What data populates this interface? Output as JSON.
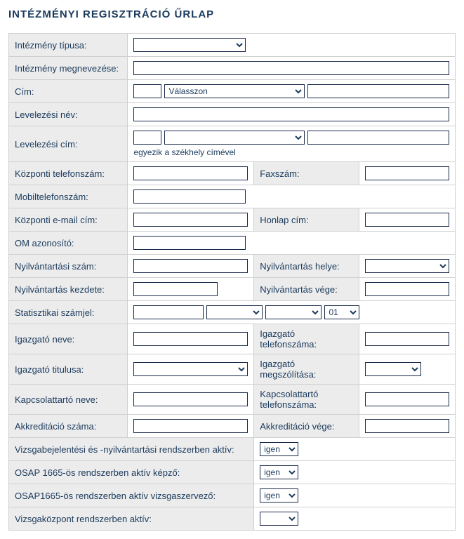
{
  "title": "INTÉZMÉNYI REGISZTRÁCIÓ ŰRLAP",
  "labels": {
    "inst_type": "Intézmény típusa:",
    "inst_name": "Intézmény megnevezése:",
    "address": "Cím:",
    "address_select_placeholder": "Válasszon",
    "mail_name": "Levelezési név:",
    "mail_address": "Levelezési cím:",
    "mail_address_hint": "egyezik a székhely címével",
    "phone": "Központi telefonszám:",
    "fax": "Faxszám:",
    "mobile": "Mobiltelefonszám:",
    "email": "Központi e-mail cím:",
    "website": "Honlap cím:",
    "om_id": "OM azonosító:",
    "reg_number": "Nyilvántartási szám:",
    "reg_place": "Nyilvántartás helye:",
    "reg_start": "Nyilvántartás kezdete:",
    "reg_end": "Nyilvántartás vége:",
    "stat_code": "Statisztikai számjel:",
    "stat_code_option": "01",
    "director_name": "Igazgató neve:",
    "director_phone": "Igazgató telefonszáma:",
    "director_title": "Igazgató titulusa:",
    "director_salutation": "Igazgató megszólítása:",
    "contact_name": "Kapcsolattartó neve:",
    "contact_phone": "Kapcsolattartó telefonszáma:",
    "accred_number": "Akkreditáció száma:",
    "accred_end": "Akkreditáció vége:",
    "vb_active": "Vizsgabejelentési és -nyilvántartási rendszerben aktív:",
    "osap_trainer": "OSAP 1665-ös rendszerben aktív képző:",
    "osap_examiner": "OSAP1665-ös rendszerben aktív vizsgaszervező:",
    "examcenter_active": "Vizsgaközpont rendszerben aktív:",
    "yes_option": "igen"
  },
  "values": {
    "inst_type": "",
    "inst_name": "",
    "addr_zip": "",
    "addr_select": "Válasszon",
    "addr_rest": "",
    "mail_name": "",
    "mail_zip": "",
    "mail_select": "",
    "mail_rest": "",
    "phone": "",
    "fax": "",
    "mobile": "",
    "email": "",
    "website": "",
    "om_id": "",
    "reg_number": "",
    "reg_place": "",
    "reg_start": "",
    "reg_end": "",
    "stat1": "",
    "stat2": "",
    "stat3": "",
    "stat4": "01",
    "director_name": "",
    "director_phone": "",
    "director_title": "",
    "director_salutation": "",
    "contact_name": "",
    "contact_phone": "",
    "accred_number": "",
    "accred_end": "",
    "vb_active": "igen",
    "osap_trainer": "igen",
    "osap_examiner": "igen",
    "examcenter_active": ""
  }
}
